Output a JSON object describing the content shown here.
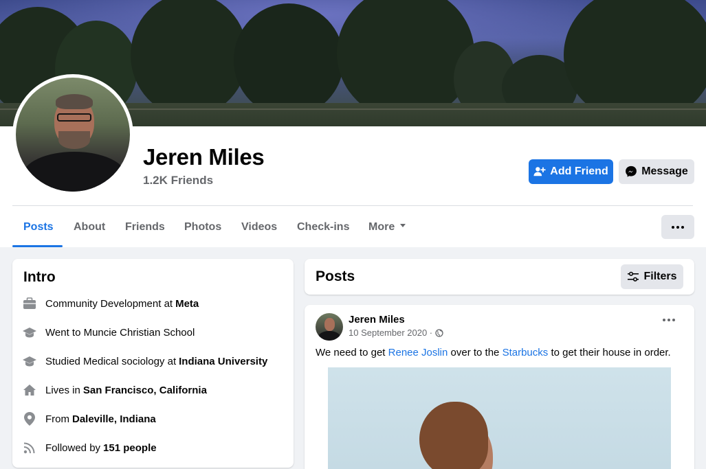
{
  "profile": {
    "name": "Jeren Miles",
    "friends_count": "1.2K Friends"
  },
  "actions": {
    "add_friend_label": "Add Friend",
    "message_label": "Message"
  },
  "tabs": [
    {
      "label": "Posts",
      "active": true
    },
    {
      "label": "About"
    },
    {
      "label": "Friends"
    },
    {
      "label": "Photos"
    },
    {
      "label": "Videos"
    },
    {
      "label": "Check-ins"
    },
    {
      "label": "More"
    }
  ],
  "intro": {
    "title": "Intro",
    "rows": [
      {
        "icon": "briefcase-icon",
        "text": "Community Development at",
        "bold": "Meta"
      },
      {
        "icon": "graduation-cap-icon",
        "text": "Went to Muncie Christian School",
        "bold": ""
      },
      {
        "icon": "graduation-cap-icon",
        "text": "Studied Medical sociology at",
        "bold": "Indiana University"
      },
      {
        "icon": "home-icon",
        "text": "Lives in",
        "bold": "San Francisco, California"
      },
      {
        "icon": "location-pin-icon",
        "text": "From",
        "bold": "Daleville, Indiana"
      },
      {
        "icon": "rss-feed-icon",
        "text": "Followed by",
        "bold": "151 people"
      }
    ]
  },
  "posts_section": {
    "title": "Posts",
    "filters_label": "Filters"
  },
  "post": {
    "author": "Jeren Miles",
    "date": "10 September 2020 ·",
    "privacy_icon": "globe-icon",
    "text_parts": {
      "before": "We need to get ",
      "link1": "Renee Joslin",
      "middle": " over to the ",
      "link2": "Starbucks",
      "after": " to get their house in order."
    }
  },
  "colors": {
    "accent": "#1b74e4",
    "secondary_text": "#65676b",
    "button_gray": "#e4e6eb"
  }
}
